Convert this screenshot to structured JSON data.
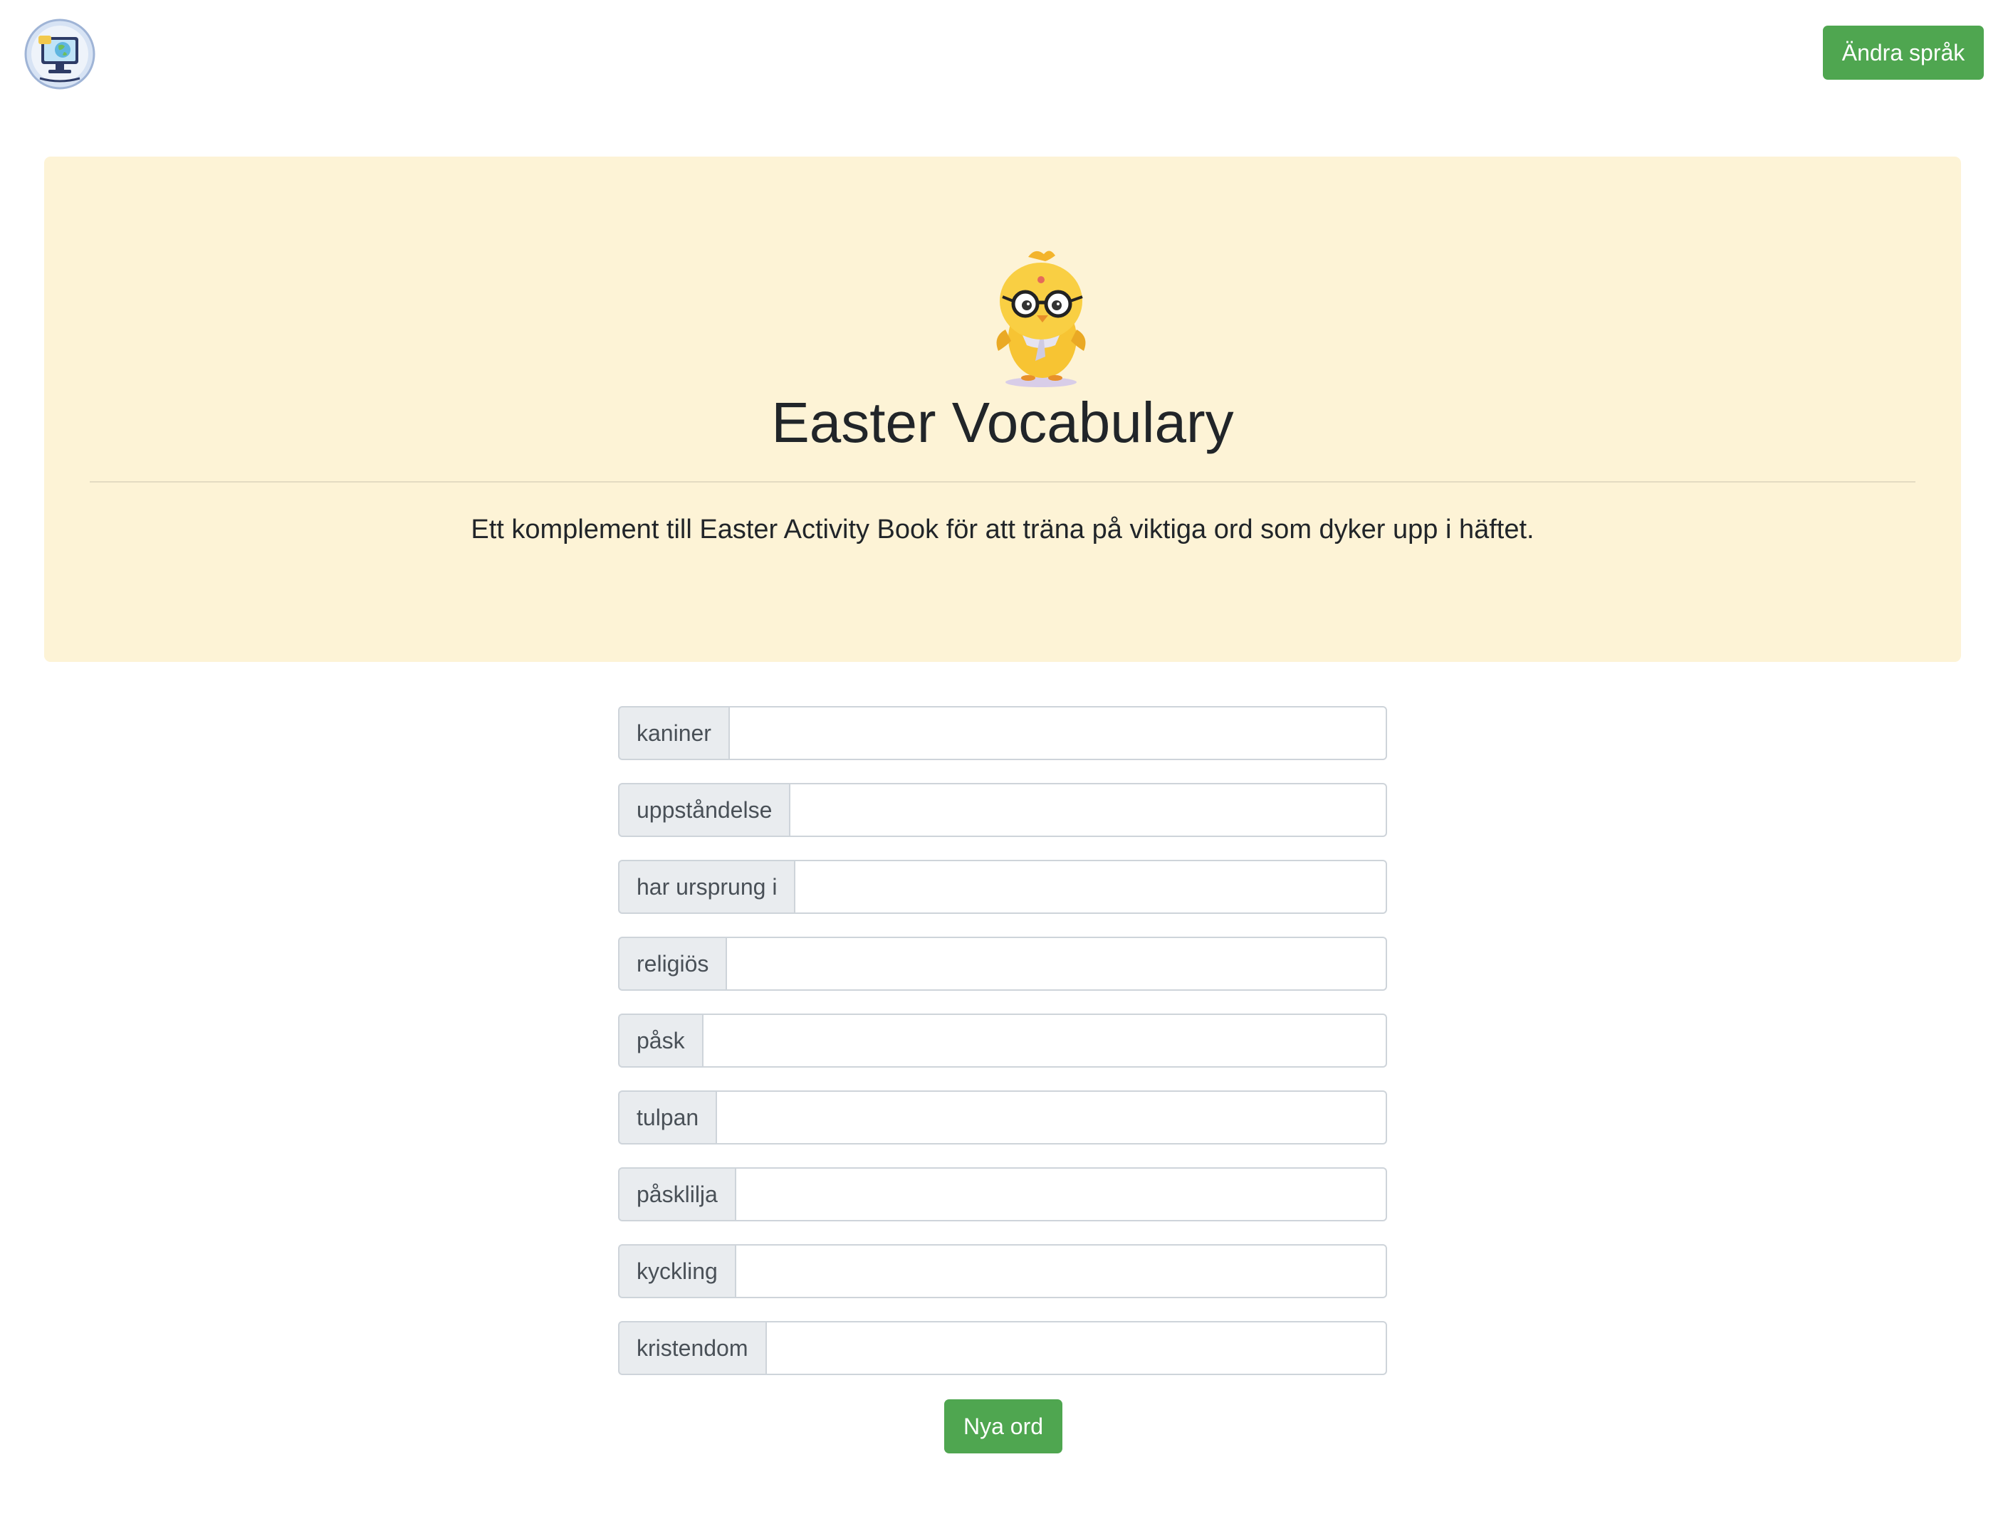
{
  "header": {
    "logo_icon": "globe-computer-logo-icon",
    "language_button_label": "Ändra språk",
    "accent_color": "#4fa650"
  },
  "hero": {
    "mascot_icon": "chick-with-glasses-icon",
    "title": "Easter Vocabulary",
    "lead": "Ett komplement till Easter Activity Book för att träna på viktiga ord som dyker upp i häftet.",
    "background_color": "#fdf3d6"
  },
  "vocab": {
    "items": [
      {
        "label": "kaniner",
        "value": ""
      },
      {
        "label": "uppståndelse",
        "value": ""
      },
      {
        "label": "har ursprung i",
        "value": ""
      },
      {
        "label": "religiös",
        "value": ""
      },
      {
        "label": "påsk",
        "value": ""
      },
      {
        "label": "tulpan",
        "value": ""
      },
      {
        "label": "påsklilja",
        "value": ""
      },
      {
        "label": "kyckling",
        "value": ""
      },
      {
        "label": "kristendom",
        "value": ""
      }
    ],
    "new_words_label": "Nya ord"
  }
}
